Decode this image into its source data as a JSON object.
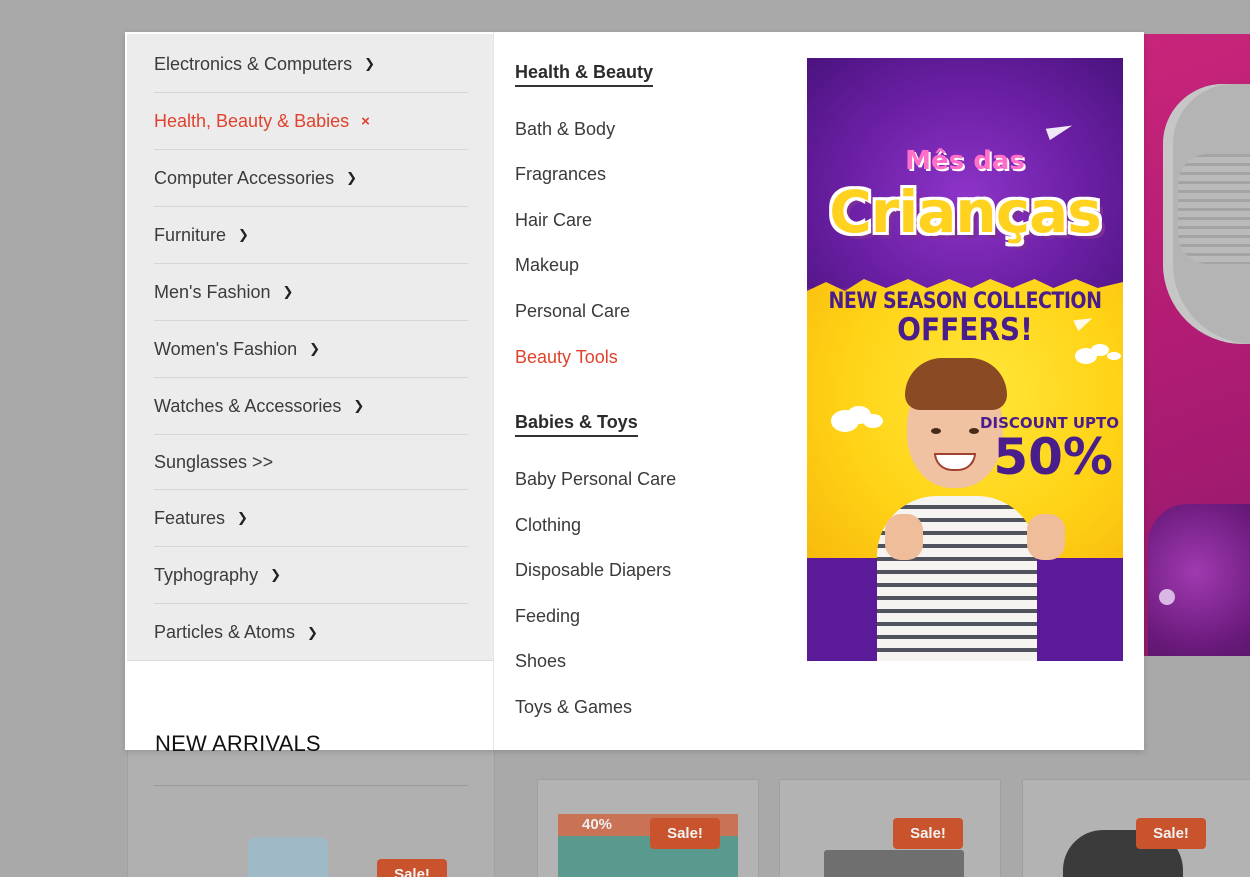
{
  "categories": [
    {
      "label": "Electronics & Computers",
      "indicator": "›"
    },
    {
      "label": "Health, Beauty & Babies",
      "indicator": "×",
      "active": true
    },
    {
      "label": "Computer Accessories",
      "indicator": "›"
    },
    {
      "label": "Furniture",
      "indicator": "›"
    },
    {
      "label": "Men's Fashion",
      "indicator": "›"
    },
    {
      "label": "Women's Fashion",
      "indicator": "›"
    },
    {
      "label": "Watches & Accessories",
      "indicator": "›"
    },
    {
      "label": "Sunglasses >>",
      "indicator": ""
    },
    {
      "label": "Features",
      "indicator": "›"
    },
    {
      "label": "Typhography",
      "indicator": "›"
    },
    {
      "label": "Particles & Atoms",
      "indicator": "›"
    }
  ],
  "submenu": {
    "groups": [
      {
        "heading": "Health & Beauty",
        "links": [
          "Bath & Body",
          "Fragrances",
          "Hair Care",
          "Makeup",
          "Personal Care",
          "Beauty Tools"
        ]
      },
      {
        "heading": "Babies & Toys",
        "links": [
          "Baby Personal Care",
          "Clothing",
          "Disposable Diapers",
          "Feeding",
          "Shoes",
          "Toys & Games"
        ]
      }
    ],
    "highlighted_link": "Beauty Tools"
  },
  "promo": {
    "logo_small": "Mês das",
    "logo_big": "Crianças",
    "headline": "NEW SEASON COLLECTION",
    "subheadline": "OFFERS!",
    "discount_label": "DISCOUNT UPTO",
    "discount_value": "50%"
  },
  "background": {
    "new_arrivals_title": "NEW ARRIVALS",
    "sale_badge": "Sale!",
    "mini_product_text": "40%"
  },
  "colors": {
    "accent": "#e0422d",
    "sale_badge": "#c9532c",
    "menu_bg": "#ececec"
  }
}
